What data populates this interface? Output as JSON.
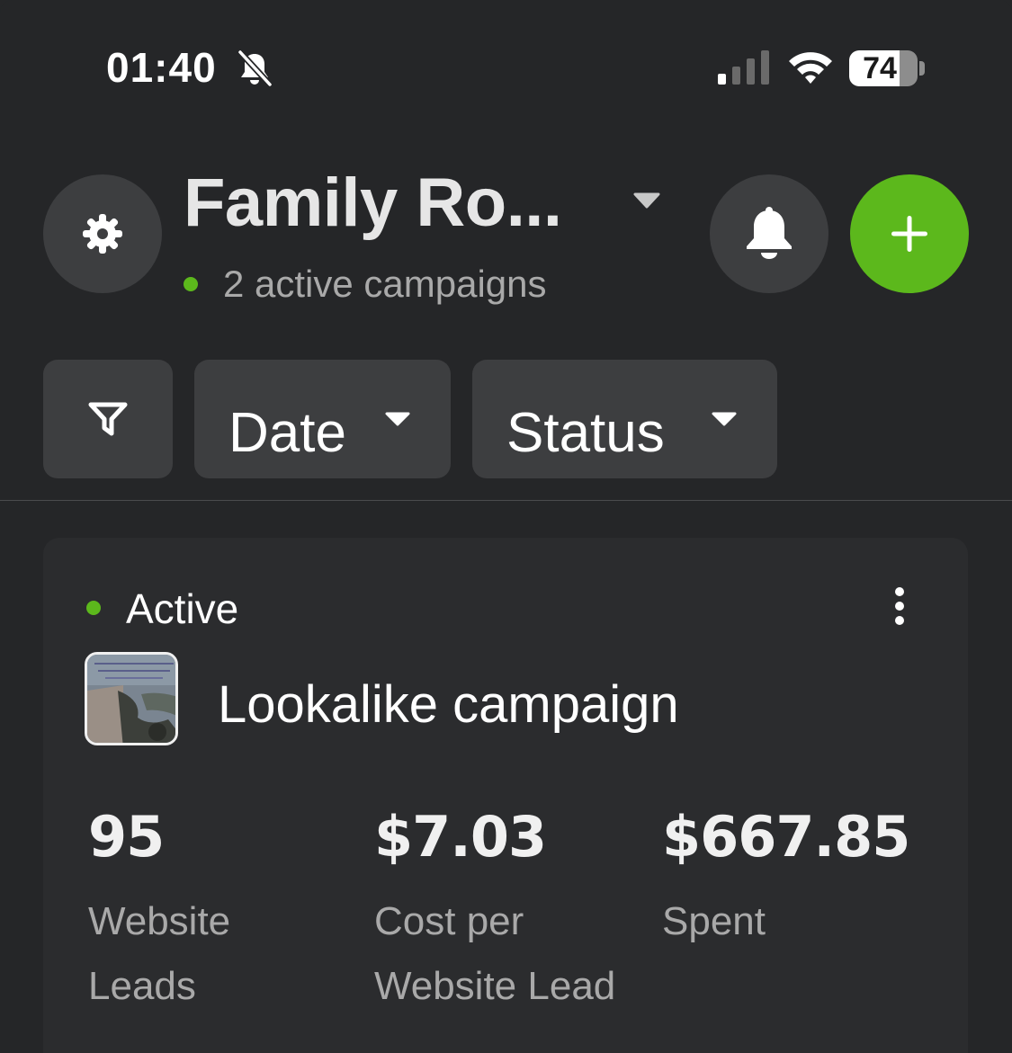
{
  "status_bar": {
    "time": "01:40",
    "battery": "74",
    "battery_level": 0.74,
    "icons": [
      "bell-slash-icon",
      "cellular-signal-icon",
      "wifi-icon",
      "battery-icon"
    ]
  },
  "header": {
    "account_title": "Family Ro...",
    "active_campaigns": "2 active campaigns",
    "icons": [
      "gear-icon",
      "caret-down-icon",
      "bell-icon",
      "plus-icon"
    ]
  },
  "filters": {
    "date_label": "Date",
    "status_label": "Status",
    "icons": [
      "funnel-icon",
      "caret-down-icon"
    ]
  },
  "campaign": {
    "status": "Active",
    "name": "Lookalike campaign",
    "metrics": [
      {
        "value": "95",
        "label_line1": "Website",
        "label_line2": "Leads"
      },
      {
        "value": "$7.03",
        "label_line1": "Cost per",
        "label_line2": "Website Lead"
      },
      {
        "value": "$667.85",
        "label_line1": "Spent",
        "label_line2": ""
      }
    ],
    "icons": [
      "more-vertical-icon",
      "campaign-thumbnail"
    ]
  },
  "colors": {
    "background": "#252628",
    "surface": "#3d3e40",
    "accent_green": "#5cb81c",
    "text_primary": "#ffffff",
    "text_secondary": "#a9a9a9"
  }
}
